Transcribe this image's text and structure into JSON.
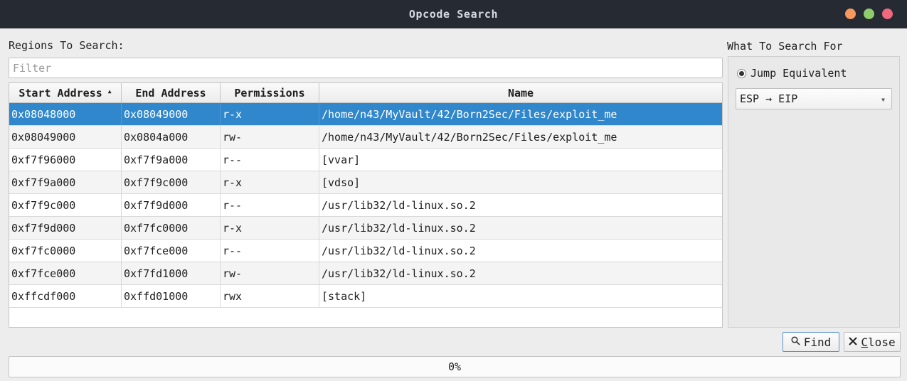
{
  "window": {
    "title": "Opcode Search"
  },
  "regions": {
    "label": "Regions To Search:",
    "filter_placeholder": "Filter",
    "filter_value": "",
    "columns": [
      "Start Address",
      "End Address",
      "Permissions",
      "Name"
    ],
    "sort_column": "Start Address",
    "sort_direction": "ascending",
    "rows": [
      [
        "0x08048000",
        "0x08049000",
        "r-x",
        "/home/n43/MyVault/42/Born2Sec/Files/exploit_me"
      ],
      [
        "0x08049000",
        "0x0804a000",
        "rw-",
        "/home/n43/MyVault/42/Born2Sec/Files/exploit_me"
      ],
      [
        "0xf7f96000",
        "0xf7f9a000",
        "r--",
        "[vvar]"
      ],
      [
        "0xf7f9a000",
        "0xf7f9c000",
        "r-x",
        "[vdso]"
      ],
      [
        "0xf7f9c000",
        "0xf7f9d000",
        "r--",
        "/usr/lib32/ld-linux.so.2"
      ],
      [
        "0xf7f9d000",
        "0xf7fc0000",
        "r-x",
        "/usr/lib32/ld-linux.so.2"
      ],
      [
        "0xf7fc0000",
        "0xf7fce000",
        "r--",
        "/usr/lib32/ld-linux.so.2"
      ],
      [
        "0xf7fce000",
        "0xf7fd1000",
        "rw-",
        "/usr/lib32/ld-linux.so.2"
      ],
      [
        "0xffcdf000",
        "0xffd01000",
        "rwx",
        "[stack]"
      ]
    ],
    "selected_row": 0
  },
  "search_for": {
    "label": "What To Search For",
    "option_label": "Jump Equivalent",
    "option_checked": true,
    "combo_value": "ESP → EIP"
  },
  "buttons": {
    "find": "Find",
    "close": "Close"
  },
  "progress": {
    "value": 0,
    "text": "0%"
  },
  "colors": {
    "selection": "#3087cb",
    "titlebar": "#252a33"
  }
}
